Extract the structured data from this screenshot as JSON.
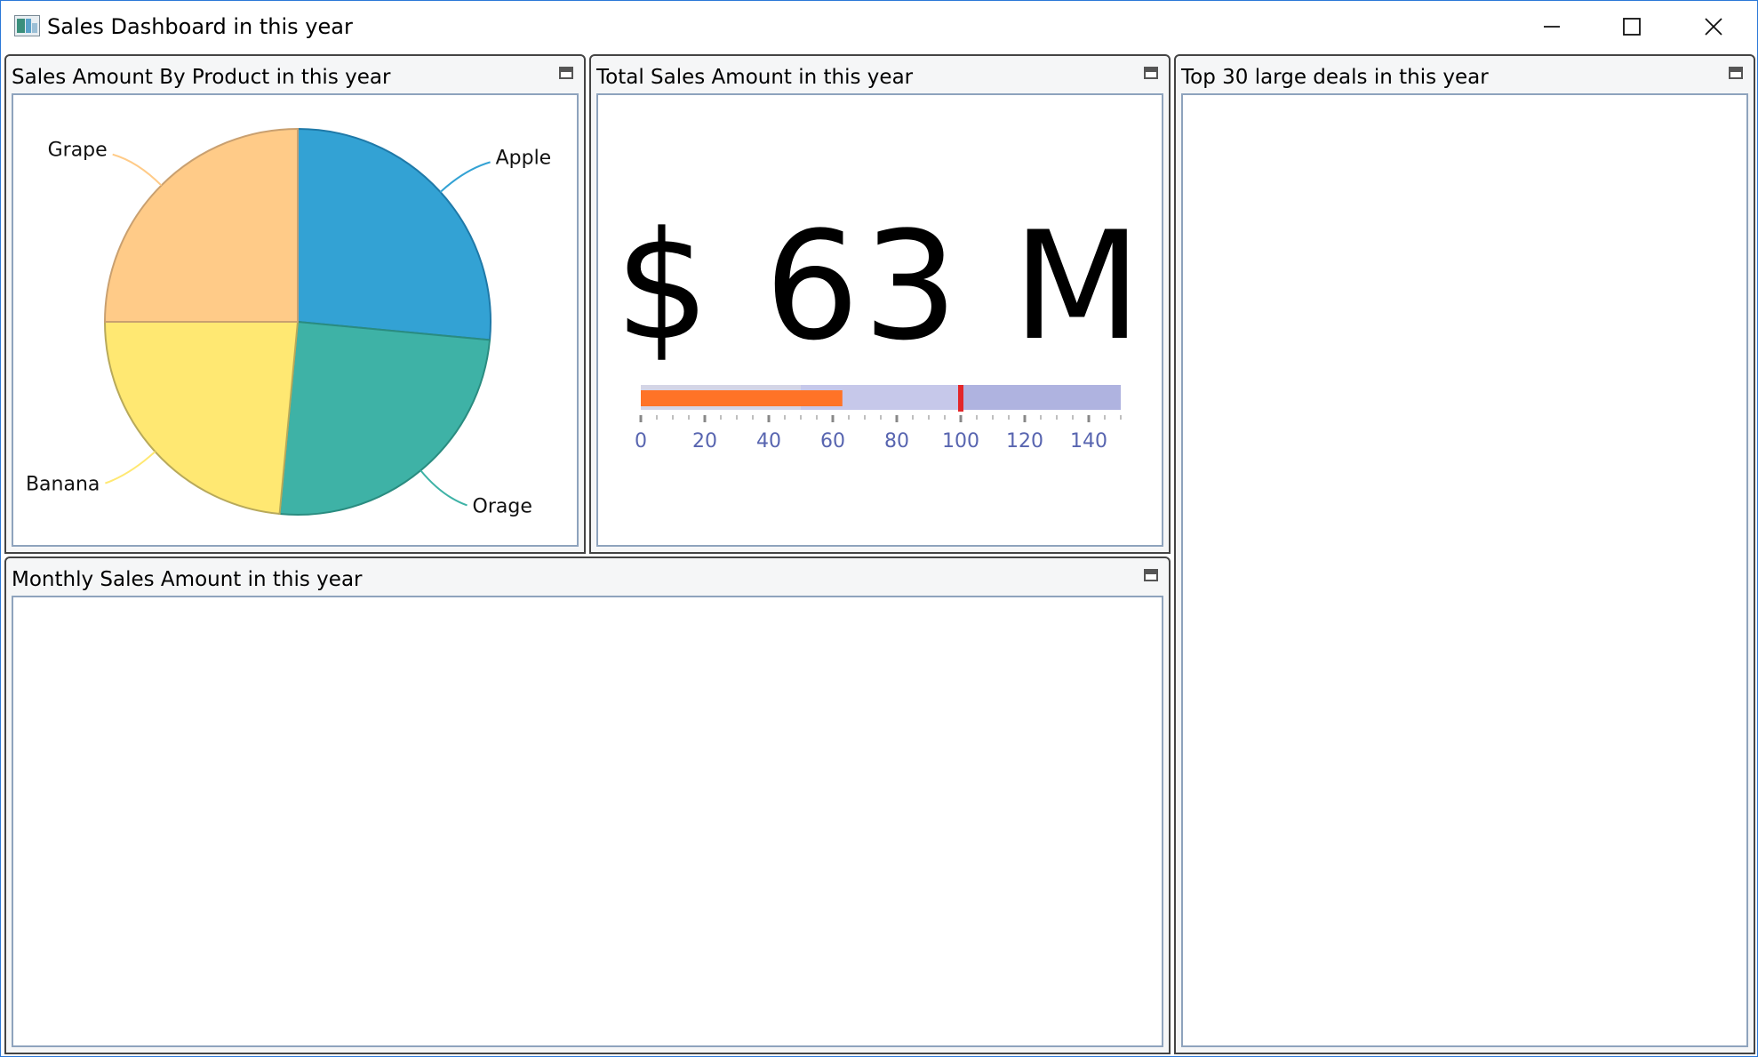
{
  "window": {
    "title": "Sales Dashboard in this year"
  },
  "panels": {
    "pie": {
      "title": "Sales Amount By Product in this year"
    },
    "total": {
      "title": "Total Sales Amount in this year",
      "value_text": "$ 63 M"
    },
    "deals": {
      "title": "Top 30 large deals in this year"
    },
    "monthly": {
      "title": "Monthly Sales Amount in this year"
    }
  },
  "icons": {
    "app": "app-chart-icon",
    "minimize": "minimize-icon",
    "maximize": "maximize-icon",
    "close": "close-icon",
    "panel_toggle": "panel-minimize-icon"
  },
  "chart_data": [
    {
      "type": "pie",
      "categories": [
        "Apple",
        "Orage",
        "Banana",
        "Grape"
      ],
      "values": [
        26.5,
        25.0,
        23.5,
        25.0
      ],
      "colors": [
        "#33a2d4",
        "#3eb2a6",
        "#ffe872",
        "#ffcb88"
      ],
      "edge_colors": [
        "#1f79a8",
        "#2a8c80",
        "#b8a95a",
        "#c9a070"
      ],
      "start_angle_deg": 0,
      "direction": "clockwise"
    },
    {
      "type": "bullet",
      "value": 63,
      "target": 100,
      "range_bands": [
        50,
        100,
        150
      ],
      "band_colors": [
        "#d4d5e6",
        "#c6c8ea",
        "#afb3e0"
      ],
      "bar_color": "#ff7327",
      "target_color": "#e3262a",
      "axis_min": 0,
      "axis_max": 150,
      "major_ticks": [
        0,
        20,
        40,
        60,
        80,
        100,
        120,
        140
      ],
      "tick_labels": [
        "0",
        "20",
        "40",
        "60",
        "80",
        "100",
        "120",
        "140"
      ],
      "tick_label_color": "#5865b0"
    }
  ]
}
